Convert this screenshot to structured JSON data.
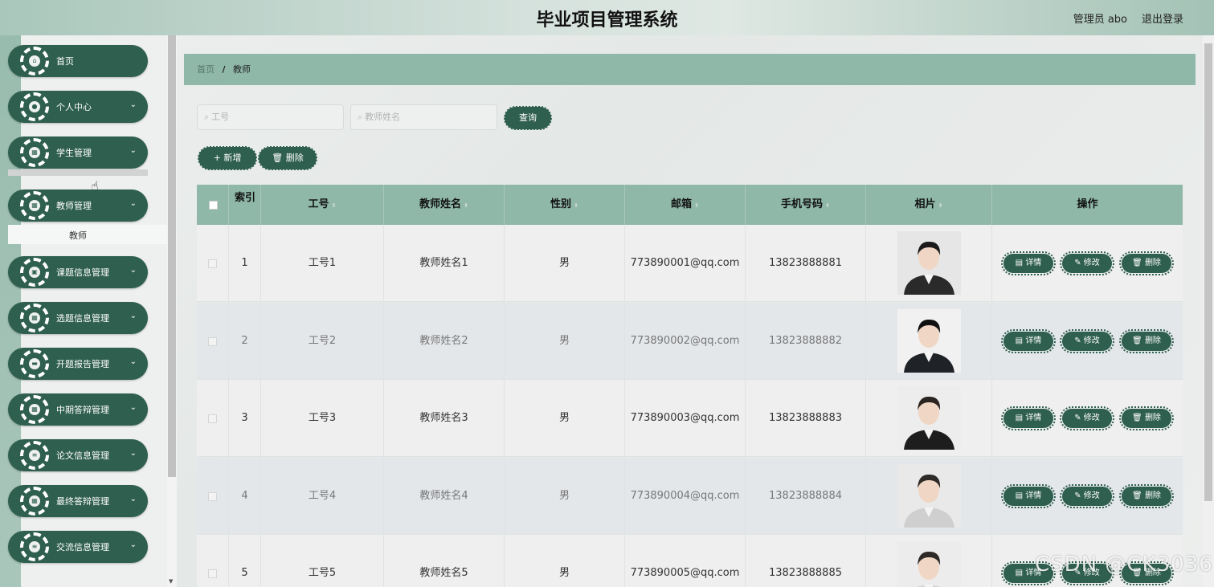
{
  "header": {
    "title": "毕业项目管理系统",
    "user": "管理员 abo",
    "logout": "退出登录"
  },
  "sidebar": {
    "items": [
      {
        "label": "首页",
        "icon": "home-icon",
        "glyph": "⌂",
        "top": 0,
        "chevron": ""
      },
      {
        "label": "个人中心",
        "icon": "person-icon",
        "glyph": "●",
        "chevron": "⌄"
      },
      {
        "label": "学生管理",
        "icon": "grid-icon",
        "glyph": "▦",
        "chevron": "⌄"
      },
      {
        "label": "教师管理",
        "icon": "grid-icon",
        "glyph": "▦",
        "chevron": "⌄"
      },
      {
        "label": "课题信息管理",
        "icon": "clipboard-icon",
        "glyph": "▣",
        "chevron": "⌄"
      },
      {
        "label": "选题信息管理",
        "icon": "grid-icon",
        "glyph": "▦",
        "chevron": "⌄"
      },
      {
        "label": "开题报告管理",
        "icon": "chat-icon",
        "glyph": "▬",
        "chevron": "⌄"
      },
      {
        "label": "中期答辩管理",
        "icon": "grid-icon",
        "glyph": "▦",
        "chevron": "⌄"
      },
      {
        "label": "论文信息管理",
        "icon": "list-icon",
        "glyph": "≡",
        "chevron": "⌄"
      },
      {
        "label": "最终答辩管理",
        "icon": "grid-icon",
        "glyph": "▦",
        "chevron": "⌄"
      },
      {
        "label": "交流信息管理",
        "icon": "list-icon",
        "glyph": "≡",
        "chevron": "⌄"
      }
    ],
    "sub_item": "教师"
  },
  "breadcrumb": {
    "home": "首页",
    "separator": "/",
    "current": "教师"
  },
  "search": {
    "id_placeholder": "工号",
    "name_placeholder": "教师姓名",
    "query_button": "查询"
  },
  "toolbar": {
    "add_button": "+ 新增",
    "delete_button": "删除"
  },
  "table": {
    "columns": {
      "index": "索引",
      "id": "工号",
      "name": "教师姓名",
      "gender": "性别",
      "email": "邮箱",
      "phone": "手机号码",
      "photo": "相片",
      "actions": "操作"
    },
    "rows": [
      {
        "index": "1",
        "id": "工号1",
        "name": "教师姓名1",
        "gender": "男",
        "email": "773890001@qq.com",
        "phone": "13823888881"
      },
      {
        "index": "2",
        "id": "工号2",
        "name": "教师姓名2",
        "gender": "男",
        "email": "773890002@qq.com",
        "phone": "13823888882"
      },
      {
        "index": "3",
        "id": "工号3",
        "name": "教师姓名3",
        "gender": "男",
        "email": "773890003@qq.com",
        "phone": "13823888883"
      },
      {
        "index": "4",
        "id": "工号4",
        "name": "教师姓名4",
        "gender": "男",
        "email": "773890004@qq.com",
        "phone": "13823888884"
      },
      {
        "index": "5",
        "id": "工号5",
        "name": "教师姓名5",
        "gender": "男",
        "email": "773890005@qq.com",
        "phone": "13823888885"
      }
    ],
    "actions": {
      "detail": "详情",
      "edit": "修改",
      "delete": "删除"
    }
  },
  "watermark": "CSDN @CK3036",
  "colors": {
    "primary": "#2f5f4e",
    "header_bg": "#8fb8a9"
  }
}
